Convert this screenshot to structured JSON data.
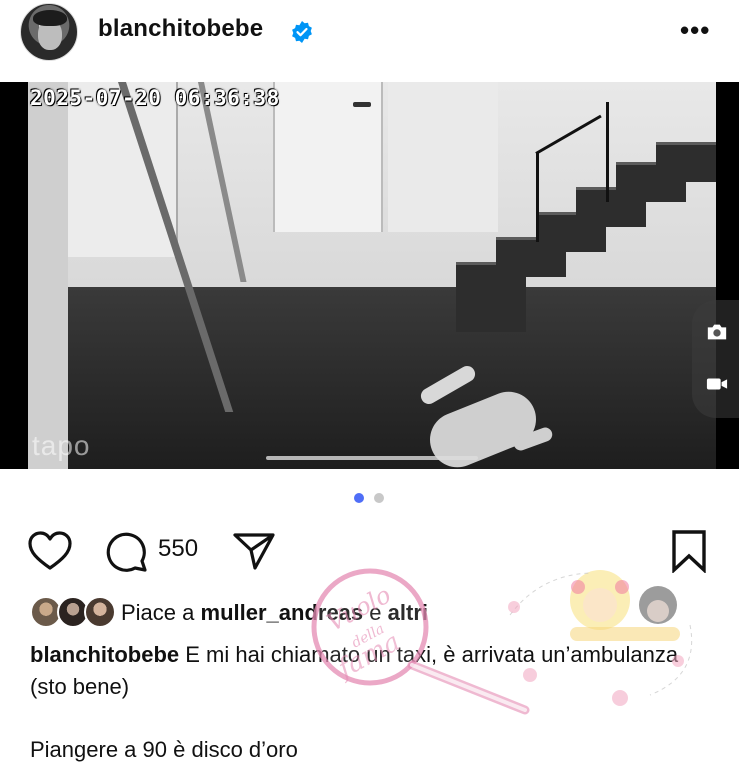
{
  "header": {
    "username": "blanchitobebe",
    "verified_icon": "verified-badge-icon",
    "more_label": "•••"
  },
  "media": {
    "timestamp": "2025-07-20 06:36:38",
    "camera_brand": "tapo",
    "carousel": {
      "total": 2,
      "active_index": 0
    },
    "side_controls": [
      "camera-icon",
      "video-record-icon"
    ]
  },
  "actions": {
    "comment_count": "550",
    "icons": [
      "heart-icon",
      "comment-icon",
      "share-icon",
      "bookmark-icon"
    ]
  },
  "likes": {
    "prefix": "Piace a",
    "user": "muller_andreas",
    "connector": "e",
    "others": "altri"
  },
  "caption": {
    "author": "blanchitobebe",
    "text": "E mi hai chiamato un taxi, è arrivata un’ambulanza (sto bene)",
    "line2": "Piangere a 90 è disco d’oro"
  },
  "watermark": {
    "line1": "Vuolo",
    "line2": "della",
    "line3": "fama"
  },
  "colors": {
    "verified": "#0095f6",
    "dot_active": "#4f6ef7",
    "dot_inactive": "#c8c8c8",
    "watermark_pink": "#e58bb4"
  }
}
